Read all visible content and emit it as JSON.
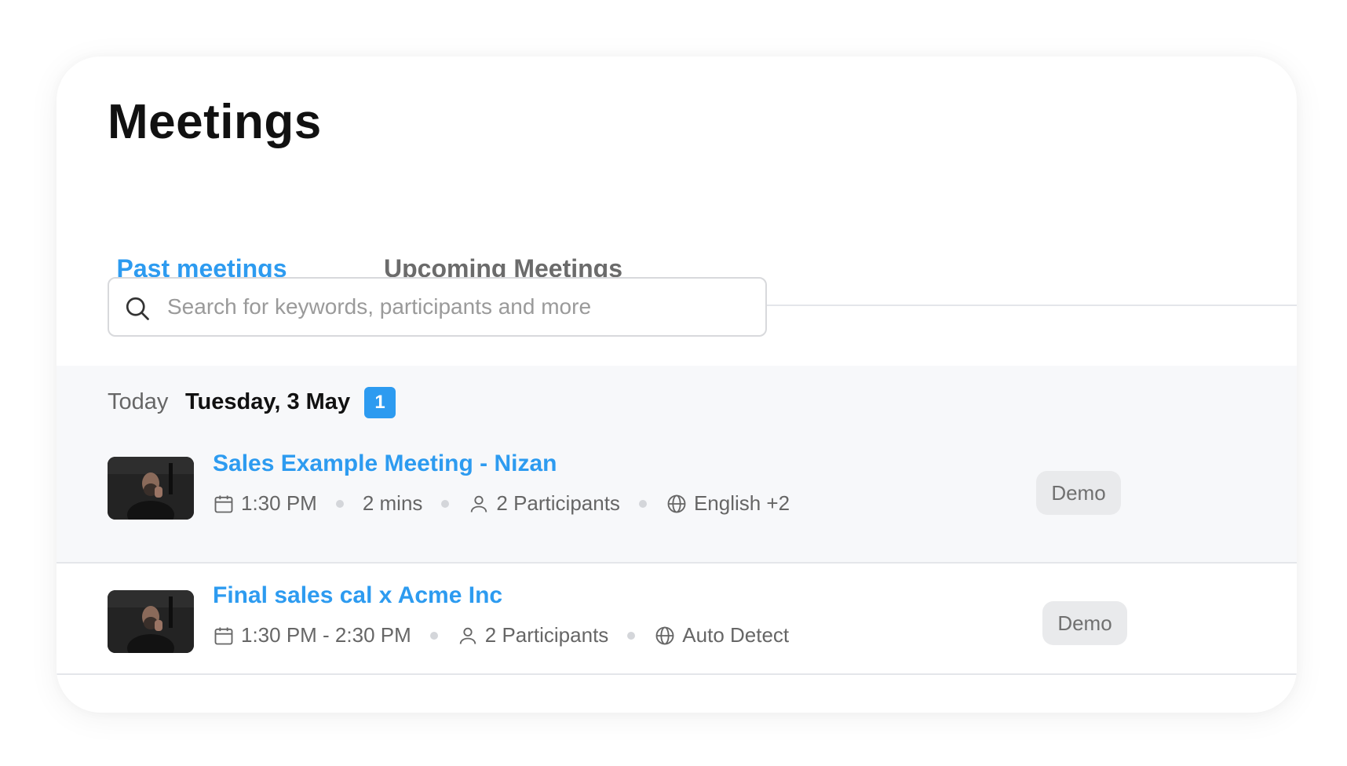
{
  "page": {
    "title": "Meetings"
  },
  "tabs": [
    {
      "label": "Past meetings",
      "active": true
    },
    {
      "label": "Upcoming Meetings",
      "active": false
    }
  ],
  "search": {
    "placeholder": "Search for keywords, participants and more",
    "value": ""
  },
  "group": {
    "relative_day": "Today",
    "date": "Tuesday, 3 May",
    "count": "1"
  },
  "meetings": [
    {
      "title": "Sales Example Meeting - Nizan",
      "time": "1:30 PM",
      "duration": "2 mins",
      "participants": "2 Participants",
      "language": "English +2",
      "badge": "Demo"
    },
    {
      "title": "Final sales cal x Acme Inc",
      "time": "1:30 PM - 2:30 PM",
      "participants": "2 Participants",
      "language": "Auto Detect",
      "badge": "Demo"
    }
  ],
  "colors": {
    "accent": "#2d9bf0",
    "title_text": "#111111",
    "muted_text": "#666666",
    "badge_bg": "#e9eaec",
    "group_bg": "#f7f8fa"
  },
  "icons": [
    "search-icon",
    "calendar-icon",
    "person-icon",
    "globe-icon"
  ]
}
